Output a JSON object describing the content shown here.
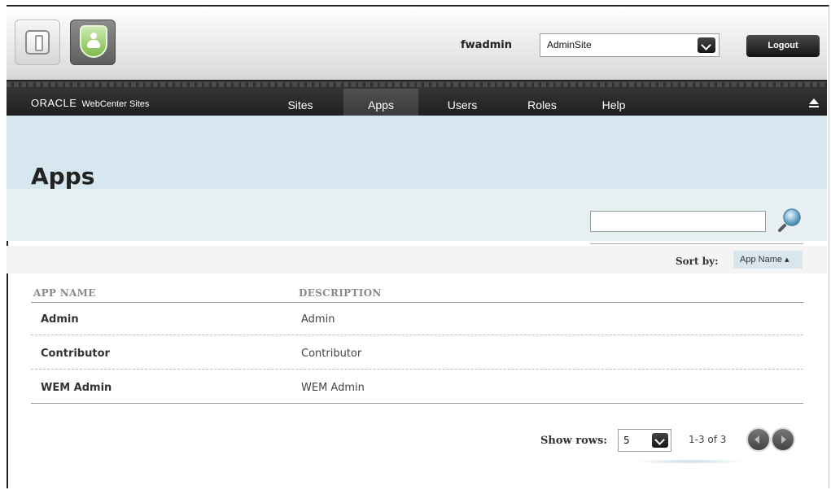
{
  "header": {
    "apps": [
      {
        "name": "fw-app",
        "icon": "door-icon"
      },
      {
        "name": "admin-app",
        "icon": "shield-user-icon"
      }
    ],
    "username": "fwadmin",
    "site_select": {
      "value": "AdminSite"
    },
    "logout_label": "Logout"
  },
  "nav": {
    "brand": "ORACLE",
    "brand_sub": "WebCenter Sites",
    "items": [
      {
        "label": "Sites",
        "active": false
      },
      {
        "label": "Apps",
        "active": true
      },
      {
        "label": "Users",
        "active": false
      },
      {
        "label": "Roles",
        "active": false
      },
      {
        "label": "Help",
        "active": false
      }
    ]
  },
  "page": {
    "title": "Apps",
    "search": {
      "value": "",
      "placeholder": ""
    },
    "sort_label": "Sort by:",
    "sort_value": "App Name ▴"
  },
  "table": {
    "columns": [
      "APP NAME",
      "DESCRIPTION"
    ],
    "rows": [
      {
        "name": "Admin",
        "description": "Admin"
      },
      {
        "name": "Contributor",
        "description": "Contributor"
      },
      {
        "name": "WEM Admin",
        "description": "WEM Admin"
      }
    ]
  },
  "pager": {
    "show_rows_label": "Show rows:",
    "rows_value": "5",
    "range": "1-3 of 3"
  },
  "colors": {
    "title_band": "#d7e7ef",
    "nav_bg": "#2a2a2a",
    "accent_green": "#7fb94a"
  }
}
